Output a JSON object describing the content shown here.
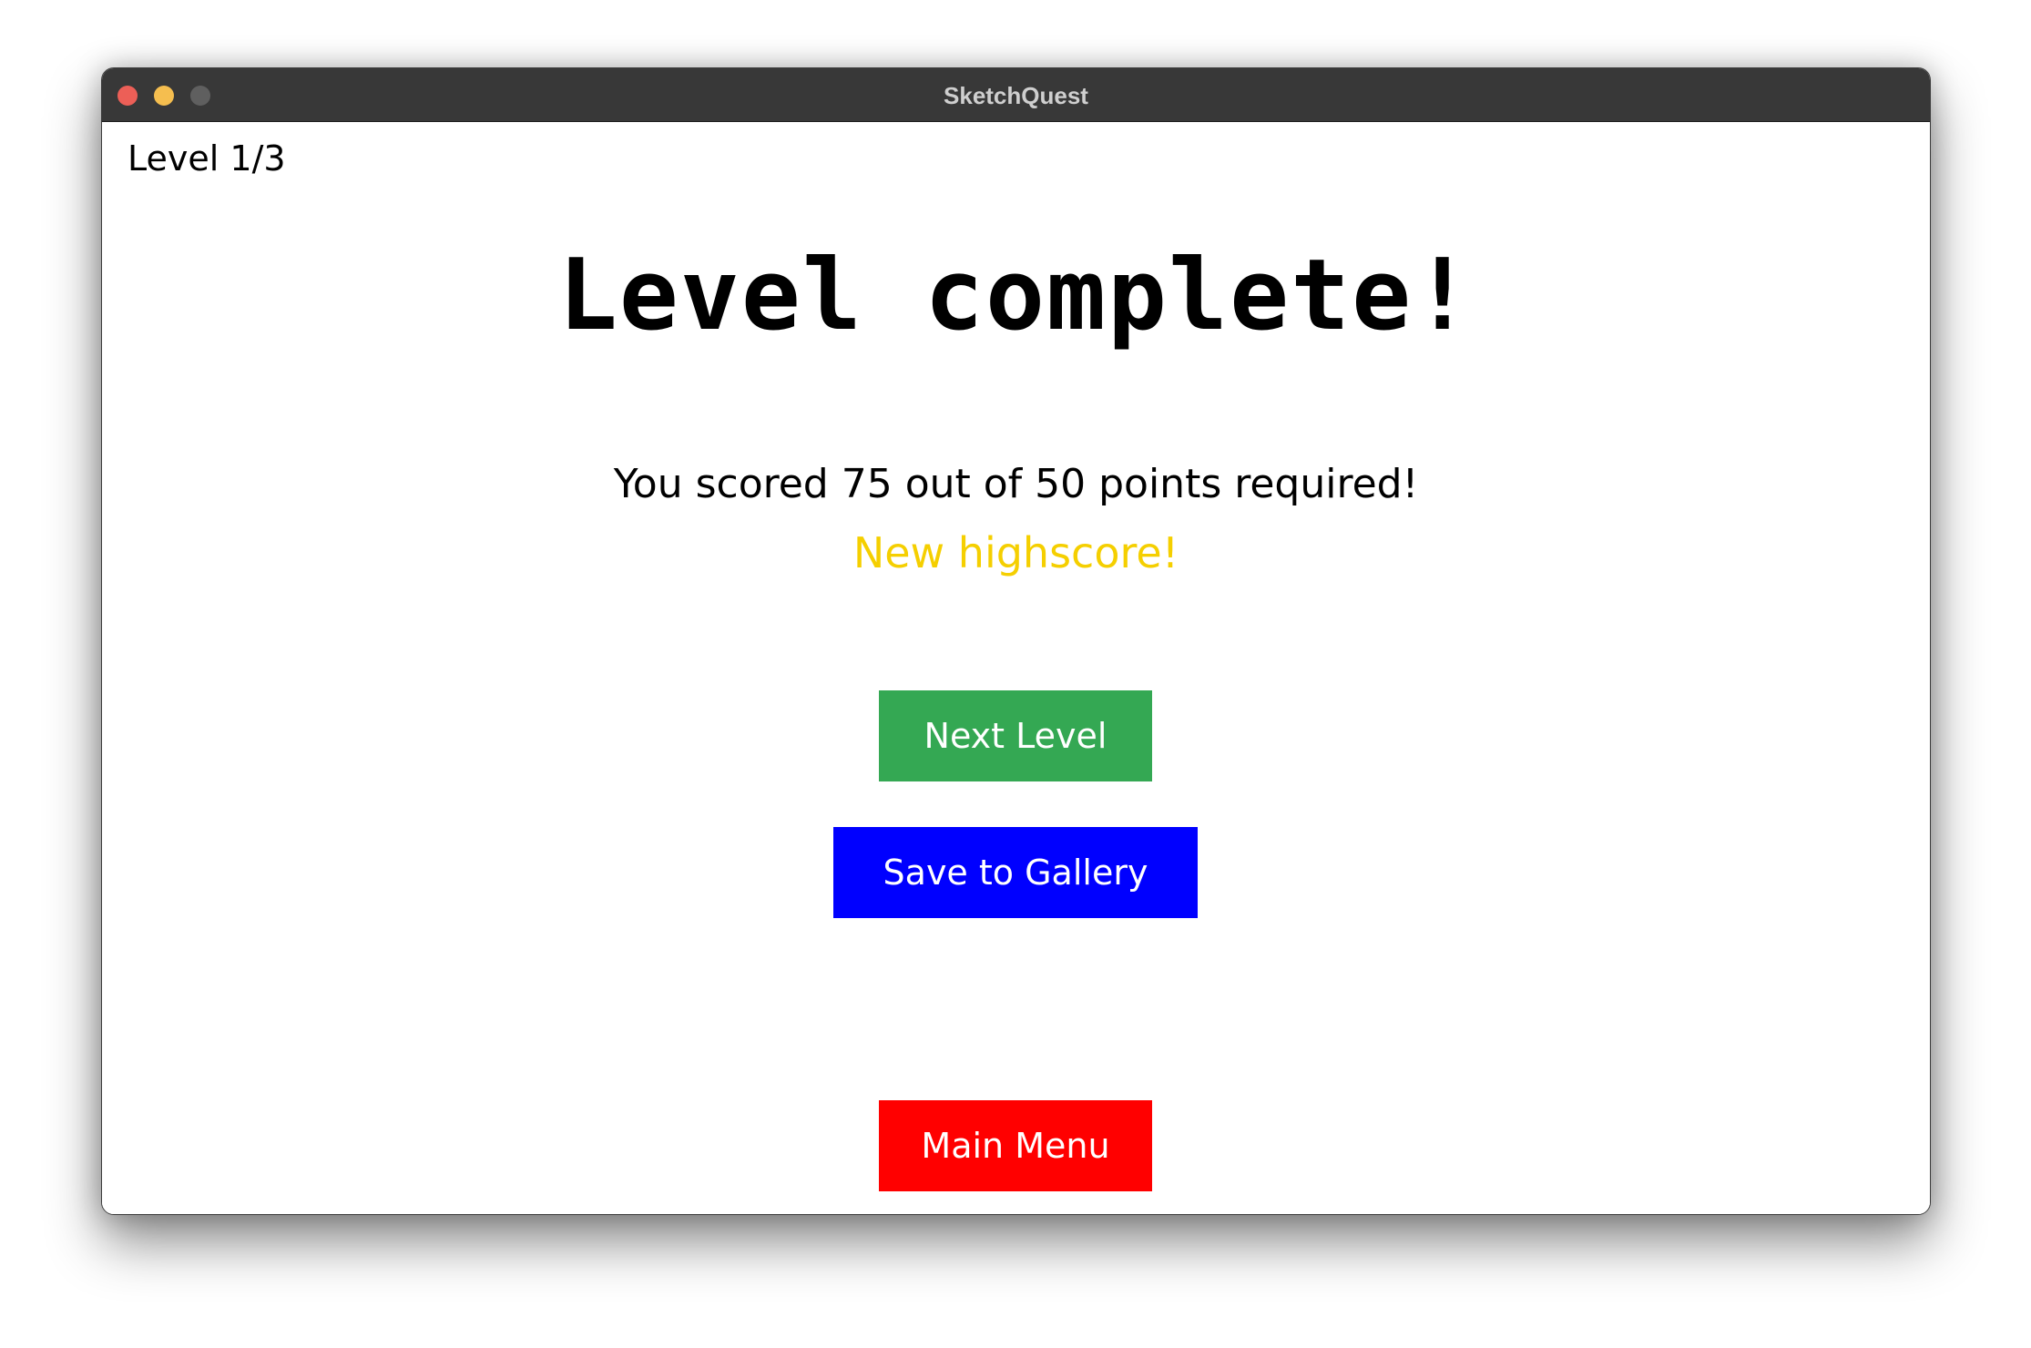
{
  "window": {
    "title": "SketchQuest",
    "controls": {
      "close_color": "#ec5f57",
      "minimize_color": "#f5be4f",
      "maximize_color": "#5f5f5f"
    }
  },
  "game": {
    "level_indicator": "Level 1/3",
    "heading": "Level complete!",
    "score_message": "You scored 75 out of 50 points required!",
    "score": 75,
    "required_points": 50,
    "highscore_message": "New highscore!",
    "highscore_color": "#f5cf00"
  },
  "buttons": {
    "next_level": {
      "label": "Next Level",
      "color": "#34a853"
    },
    "save_to_gallery": {
      "label": "Save to Gallery",
      "color": "#0000ff"
    },
    "main_menu": {
      "label": "Main Menu",
      "color": "#ff0000"
    }
  }
}
